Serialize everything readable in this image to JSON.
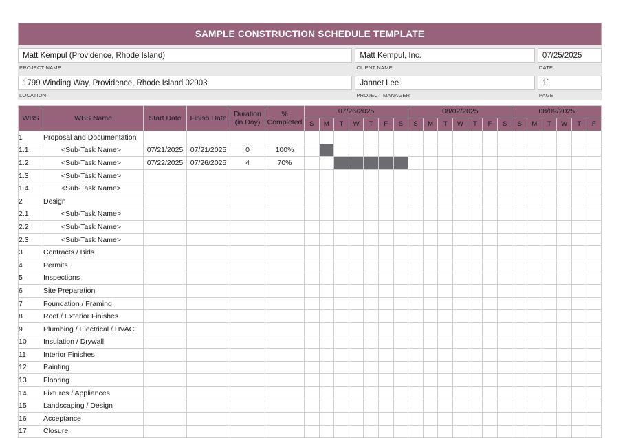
{
  "document": {
    "title": "SAMPLE CONSTRUCTION SCHEDULE TEMPLATE"
  },
  "colors": {
    "header_mauve": "#96637a",
    "gantt_bar": "#6b6b70",
    "meta_band": "#e9e9e9",
    "grid_line": "#cfcfcf"
  },
  "meta": {
    "project_name": {
      "value": "Matt Kempul (Providence, Rhode Island)",
      "label": "PROJECT NAME",
      "placeholder": "Project Name"
    },
    "client_name": {
      "value": "Matt Kempul, Inc.",
      "label": "CLIENT NAME",
      "placeholder": "Client Name"
    },
    "date": {
      "value": "07/25/2025",
      "label": "DATE",
      "placeholder": "Date"
    },
    "location": {
      "value": "1799  Winding Way, Providence, Rhode Island   02903",
      "label": "LOCATION",
      "placeholder": "Location"
    },
    "project_manager": {
      "value": "Jannet Lee",
      "label": "PROJECT MANAGER",
      "placeholder": "Project Manager"
    },
    "page": {
      "value": "1`",
      "label": "PAGE",
      "placeholder": "Page"
    }
  },
  "table": {
    "headers": {
      "wbs": "WBS",
      "wbs_name": "WBS Name",
      "start_date": "Start Date",
      "finish_date": "Finish Date",
      "duration_line1": "Duration",
      "duration_line2": "(in Day)",
      "pct_line1": "%",
      "pct_line2": "Completed"
    },
    "weeks": [
      {
        "label": "07/26/2025",
        "days": [
          "S",
          "M",
          "T",
          "W",
          "T",
          "F",
          "S"
        ]
      },
      {
        "label": "08/02/2025",
        "days": [
          "S",
          "M",
          "T",
          "W",
          "T",
          "F",
          "S"
        ]
      },
      {
        "label": "08/09/2025",
        "days": [
          "S",
          "M",
          "T",
          "W",
          "T",
          "F"
        ]
      }
    ],
    "day_count": 20,
    "rows": [
      {
        "wbs": "1",
        "name": "Proposal and Documentation",
        "sub": false,
        "start": "",
        "finish": "",
        "duration": "",
        "pct": "",
        "bars": []
      },
      {
        "wbs": "1.1",
        "name": "<Sub-Task Name>",
        "sub": true,
        "start": "07/21/2025",
        "finish": "07/21/2025",
        "duration": "0",
        "pct": "100%",
        "bars": [
          1
        ]
      },
      {
        "wbs": "1.2",
        "name": "<Sub-Task Name>",
        "sub": true,
        "start": "07/22/2025",
        "finish": "07/26/2025",
        "duration": "4",
        "pct": "70%",
        "bars": [
          2,
          3,
          4,
          5,
          6
        ]
      },
      {
        "wbs": "1.3",
        "name": "<Sub-Task Name>",
        "sub": true,
        "start": "",
        "finish": "",
        "duration": "",
        "pct": "",
        "bars": []
      },
      {
        "wbs": "1.4",
        "name": "<Sub-Task Name>",
        "sub": true,
        "start": "",
        "finish": "",
        "duration": "",
        "pct": "",
        "bars": []
      },
      {
        "wbs": "2",
        "name": "Design",
        "sub": false,
        "start": "",
        "finish": "",
        "duration": "",
        "pct": "",
        "bars": []
      },
      {
        "wbs": "2.1",
        "name": "<Sub-Task Name>",
        "sub": true,
        "start": "",
        "finish": "",
        "duration": "",
        "pct": "",
        "bars": []
      },
      {
        "wbs": "2.2",
        "name": "<Sub-Task Name>",
        "sub": true,
        "start": "",
        "finish": "",
        "duration": "",
        "pct": "",
        "bars": []
      },
      {
        "wbs": "2.3",
        "name": "<Sub-Task Name>",
        "sub": true,
        "start": "",
        "finish": "",
        "duration": "",
        "pct": "",
        "bars": []
      },
      {
        "wbs": "3",
        "name": "Contracts / Bids",
        "sub": false,
        "start": "",
        "finish": "",
        "duration": "",
        "pct": "",
        "bars": []
      },
      {
        "wbs": "4",
        "name": "Permits",
        "sub": false,
        "start": "",
        "finish": "",
        "duration": "",
        "pct": "",
        "bars": []
      },
      {
        "wbs": "5",
        "name": "Inspections",
        "sub": false,
        "start": "",
        "finish": "",
        "duration": "",
        "pct": "",
        "bars": []
      },
      {
        "wbs": "6",
        "name": "Site Preparation",
        "sub": false,
        "start": "",
        "finish": "",
        "duration": "",
        "pct": "",
        "bars": []
      },
      {
        "wbs": "7",
        "name": "Foundation / Framing",
        "sub": false,
        "start": "",
        "finish": "",
        "duration": "",
        "pct": "",
        "bars": []
      },
      {
        "wbs": "8",
        "name": "Roof / Exterior Finishes",
        "sub": false,
        "start": "",
        "finish": "",
        "duration": "",
        "pct": "",
        "bars": []
      },
      {
        "wbs": "9",
        "name": "Plumbing / Electrical / HVAC",
        "sub": false,
        "start": "",
        "finish": "",
        "duration": "",
        "pct": "",
        "bars": []
      },
      {
        "wbs": "10",
        "name": "Insulation / Drywall",
        "sub": false,
        "start": "",
        "finish": "",
        "duration": "",
        "pct": "",
        "bars": []
      },
      {
        "wbs": "11",
        "name": "Interior Finishes",
        "sub": false,
        "start": "",
        "finish": "",
        "duration": "",
        "pct": "",
        "bars": []
      },
      {
        "wbs": "12",
        "name": "Painting",
        "sub": false,
        "start": "",
        "finish": "",
        "duration": "",
        "pct": "",
        "bars": []
      },
      {
        "wbs": "13",
        "name": "Flooring",
        "sub": false,
        "start": "",
        "finish": "",
        "duration": "",
        "pct": "",
        "bars": []
      },
      {
        "wbs": "14",
        "name": "Fixtures / Appliances",
        "sub": false,
        "start": "",
        "finish": "",
        "duration": "",
        "pct": "",
        "bars": []
      },
      {
        "wbs": "15",
        "name": "Landscaping / Design",
        "sub": false,
        "start": "",
        "finish": "",
        "duration": "",
        "pct": "",
        "bars": []
      },
      {
        "wbs": "16",
        "name": "Acceptance",
        "sub": false,
        "start": "",
        "finish": "",
        "duration": "",
        "pct": "",
        "bars": []
      },
      {
        "wbs": "17",
        "name": "Closure",
        "sub": false,
        "start": "",
        "finish": "",
        "duration": "",
        "pct": "",
        "bars": []
      }
    ]
  }
}
